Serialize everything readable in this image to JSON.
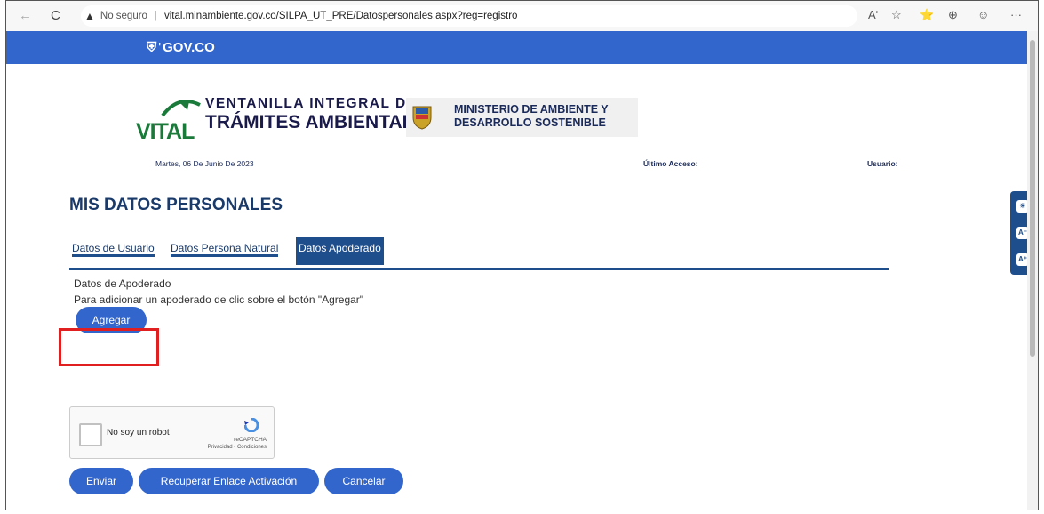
{
  "browser": {
    "back_icon": "←",
    "reload_icon": "C",
    "warning_icon": "▲",
    "not_secure": "No seguro",
    "separator": "|",
    "url": "vital.minambiente.gov.co/SILPA_UT_PRE/Datospersonales.aspx?reg=registro",
    "toolbar_icons": [
      "Aʹ",
      "☆",
      "⭐",
      "⊕",
      "☺",
      "···"
    ]
  },
  "gov_bar": {
    "logo": "GOV.CO"
  },
  "header": {
    "vital_logo": "VITAL",
    "vital_line1": "VENTANILLA INTEGRAL DE",
    "vital_line2": "TRÁMITES AMBIENTALES",
    "ministry_line1": "MINISTERIO DE AMBIENTE Y",
    "ministry_line2": "DESARROLLO SOSTENIBLE"
  },
  "info": {
    "date": "Martes, 06 De Junio De 2023",
    "last_access_label": "Último Acceso:",
    "user_label": "Usuario:"
  },
  "page_title": "MIS DATOS PERSONALES",
  "tabs": [
    {
      "label": "Datos de Usuario"
    },
    {
      "label": "Datos Persona Natural"
    },
    {
      "label": "Datos Apoderado"
    }
  ],
  "apoderado": {
    "heading": "Datos de Apoderado",
    "instruction": "Para adicionar un apoderado de clic sobre el botón \"Agregar\"",
    "add_button": "Agregar"
  },
  "captcha": {
    "label": "No soy un robot",
    "brand": "reCAPTCHA",
    "links": "Privacidad - Condiciones"
  },
  "actions": {
    "submit": "Enviar",
    "recover": "Recuperar Enlace Activación",
    "cancel": "Cancelar"
  },
  "colors": {
    "gov_blue": "#3366cc",
    "tab_blue": "#1f4e8c",
    "highlight_red": "#e02020"
  }
}
